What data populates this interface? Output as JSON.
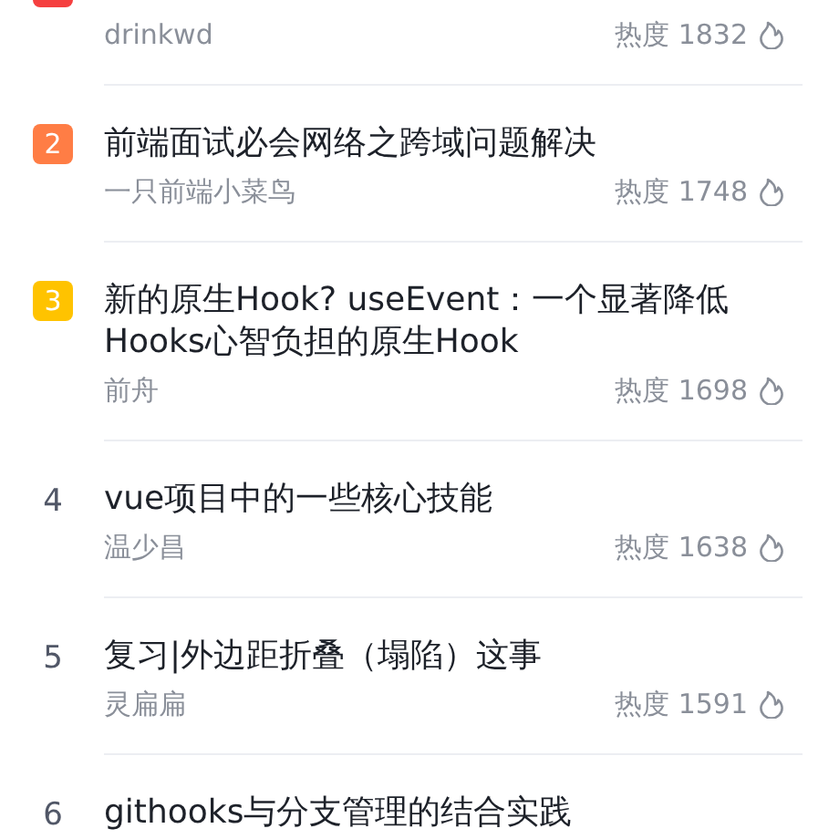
{
  "articles": [
    {
      "color": "#f53f3f",
      "author": "drinkwd",
      "heat_label": "热度",
      "heat": "1832"
    },
    {
      "rank": "2",
      "color": "#ff7d45",
      "title": "前端面试必会网络之跨域问题解决",
      "author": "一只前端小菜鸟",
      "heat_label": "热度",
      "heat": "1748"
    },
    {
      "rank": "3",
      "color": "#ffc300",
      "title": "新的原生Hook? useEvent：一个显著降低Hooks心智负担的原生Hook",
      "author": "前舟",
      "heat_label": "热度",
      "heat": "1698"
    },
    {
      "rank": "4",
      "title": "vue项目中的一些核心技能",
      "author": "温少昌",
      "heat_label": "热度",
      "heat": "1638"
    },
    {
      "rank": "5",
      "title": "复习|外边距折叠（塌陷）这事",
      "author": "灵扁扁",
      "heat_label": "热度",
      "heat": "1591"
    },
    {
      "rank": "6",
      "title": "githooks与分支管理的结合实践"
    }
  ]
}
